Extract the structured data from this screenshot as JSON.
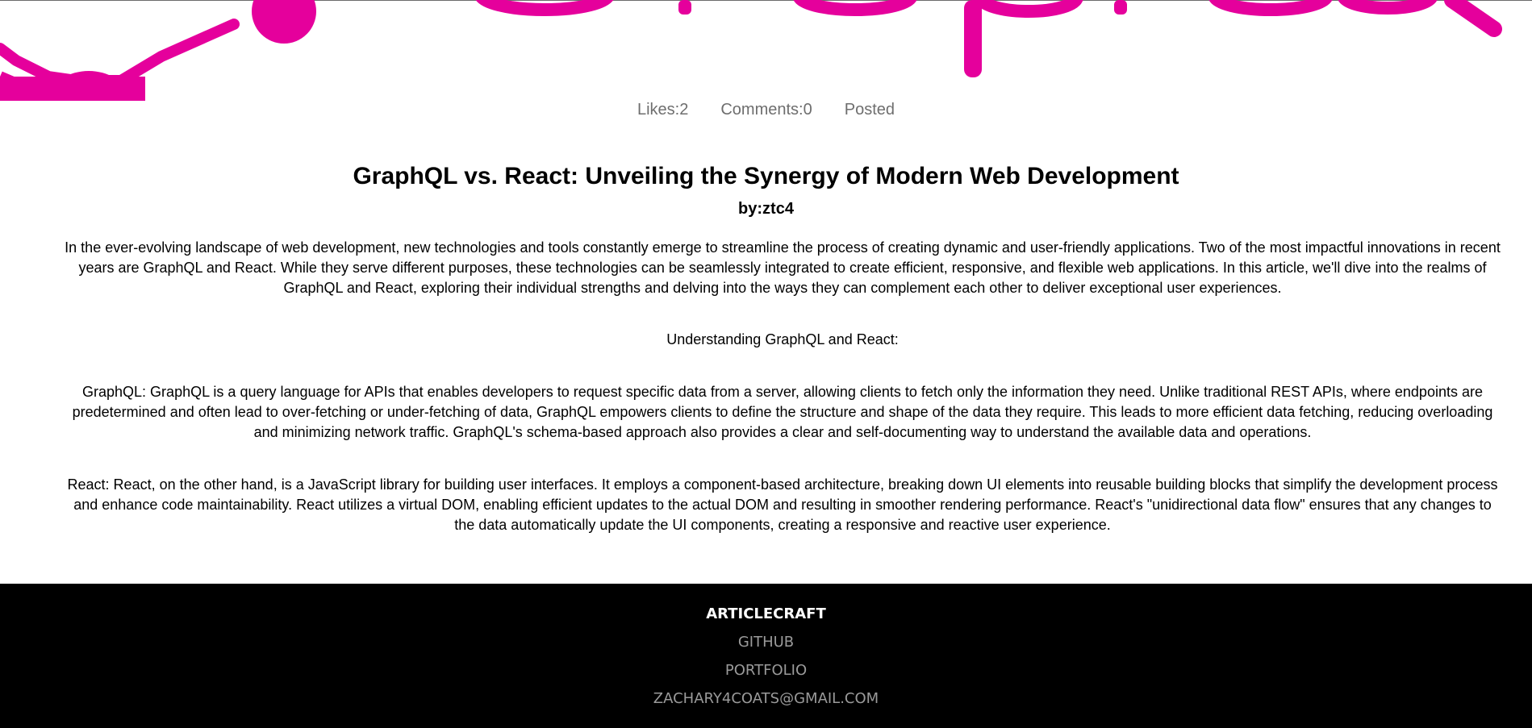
{
  "meta": {
    "likes": "Likes:2",
    "comments": "Comments:0",
    "posted": "Posted"
  },
  "article": {
    "title": "GraphQL vs. React: Unveiling the Synergy of Modern Web Development",
    "author": "by:ztc4",
    "paragraphs": [
      "In the ever-evolving landscape of web development, new technologies and tools constantly emerge to streamline the process of creating dynamic and user-friendly applications. Two of the most impactful innovations in recent years are GraphQL and React. While they serve different purposes, these technologies can be seamlessly integrated to create efficient, responsive, and flexible web applications. In this article, we'll dive into the realms of GraphQL and React, exploring their individual strengths and delving into the ways they can complement each other to deliver exceptional user experiences.",
      "Understanding GraphQL and React:",
      "GraphQL: GraphQL is a query language for APIs that enables developers to request specific data from a server, allowing clients to fetch only the information they need. Unlike traditional REST APIs, where endpoints are predetermined and often lead to over-fetching or under-fetching of data, GraphQL empowers clients to define the structure and shape of the data they require. This leads to more efficient data fetching, reducing overloading and minimizing network traffic. GraphQL's schema-based approach also provides a clear and self-documenting way to understand the available data and operations.",
      "React: React, on the other hand, is a JavaScript library for building user interfaces. It employs a component-based architecture, breaking down UI elements into reusable building blocks that simplify the development process and enhance code maintainability. React utilizes a virtual DOM, enabling efficient updates to the actual DOM and resulting in smoother rendering performance. React's \"unidirectional data flow\" ensures that any changes to the data automatically update the UI components, creating a responsive and reactive user experience."
    ]
  },
  "footer": {
    "brand": "ARTICLECRAFT",
    "links": [
      "GITHUB",
      "PORTFOLIO",
      "ZACHARY4COATS@GMAIL.COM"
    ]
  },
  "colors": {
    "accent": "#e5009c",
    "footer_bg": "#000000",
    "footer_link": "#9a9a9a",
    "meta_text": "#6e6e6e"
  },
  "icons": {
    "hero": "graphql-logo-graphic"
  }
}
